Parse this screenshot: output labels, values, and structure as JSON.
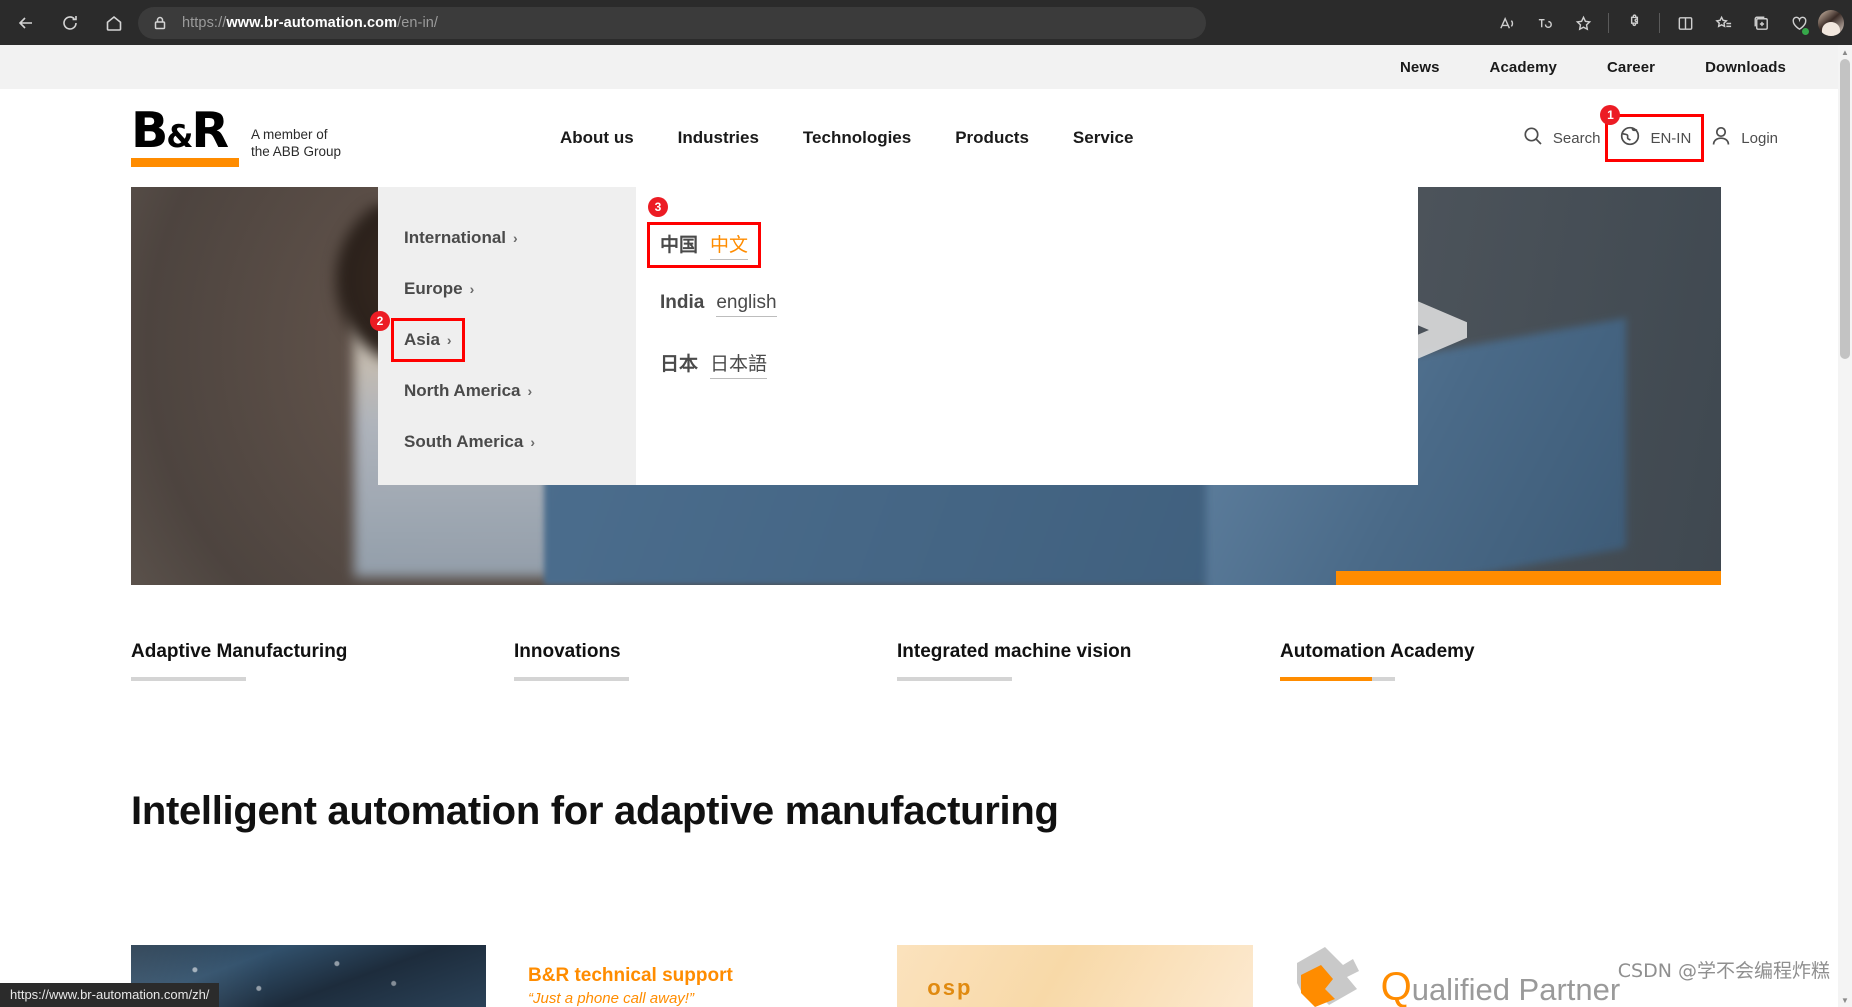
{
  "browser": {
    "url_scheme": "https://",
    "url_host": "www.br-automation.com",
    "url_path": "/en-in/",
    "back_icon": "back-arrow-icon",
    "reload_icon": "reload-icon",
    "home_icon": "home-icon",
    "lock_icon": "lock-icon",
    "toolbar_icons": [
      "read-aloud-icon",
      "translate-icon",
      "favorite-star-icon",
      "extensions-icon",
      "split-screen-icon",
      "favorites-list-icon",
      "collections-icon",
      "browser-essentials-icon",
      "profile-avatar-icon"
    ]
  },
  "statusbar": {
    "url": "https://www.br-automation.com/zh/"
  },
  "utility_nav": {
    "items": [
      {
        "label": "News"
      },
      {
        "label": "Academy"
      },
      {
        "label": "Career"
      },
      {
        "label": "Downloads"
      }
    ]
  },
  "logo": {
    "b": "B",
    "amp": "&",
    "r": "R",
    "tagline_line1": "A member of",
    "tagline_line2": "the ABB Group",
    "bar_color": "#ff8c00"
  },
  "main_nav": {
    "items": [
      {
        "label": "About us"
      },
      {
        "label": "Industries"
      },
      {
        "label": "Technologies"
      },
      {
        "label": "Products"
      },
      {
        "label": "Service"
      }
    ]
  },
  "header_right": {
    "search_label": "Search",
    "search_icon": "search-icon",
    "language_label": "EN-IN",
    "language_icon": "globe-icon",
    "login_label": "Login",
    "login_icon": "user-icon",
    "annotation_1": "1"
  },
  "language_flyout": {
    "regions": [
      {
        "label": "International",
        "chevron": "›",
        "selected": false
      },
      {
        "label": "Europe",
        "chevron": "›",
        "selected": false
      },
      {
        "label": "Asia",
        "chevron": "›",
        "selected": true,
        "annotation": "2"
      },
      {
        "label": "North America",
        "chevron": "›",
        "selected": false
      },
      {
        "label": "South America",
        "chevron": "›",
        "selected": false
      }
    ],
    "languages": [
      {
        "country": "中国",
        "language": "中文",
        "active": true,
        "selected": true,
        "annotation": "3"
      },
      {
        "country": "India",
        "language": "english",
        "active": false,
        "selected": false
      },
      {
        "country": "日本",
        "language": "日本語",
        "active": false,
        "selected": false
      }
    ]
  },
  "quicklinks": {
    "items": [
      {
        "label": "Adaptive Manufacturing",
        "active": false
      },
      {
        "label": "Innovations",
        "active": false
      },
      {
        "label": "Integrated machine vision",
        "active": false
      },
      {
        "label": "Automation Academy",
        "active": true
      }
    ]
  },
  "headline": {
    "text": "Intelligent automation for adaptive manufacturing"
  },
  "cards": {
    "support_title": "B&R technical support",
    "support_subtitle": "“Just a phone call away!”",
    "osp_label": "osp",
    "partner_q": "Q",
    "partner_rest": "ualified Partner"
  },
  "watermark": {
    "text": "CSDN @学不会编程炸糕"
  },
  "colors": {
    "brand_orange": "#ff8c00",
    "annotation_red": "#ec1c24",
    "chrome_dark": "#2b2b2b"
  }
}
